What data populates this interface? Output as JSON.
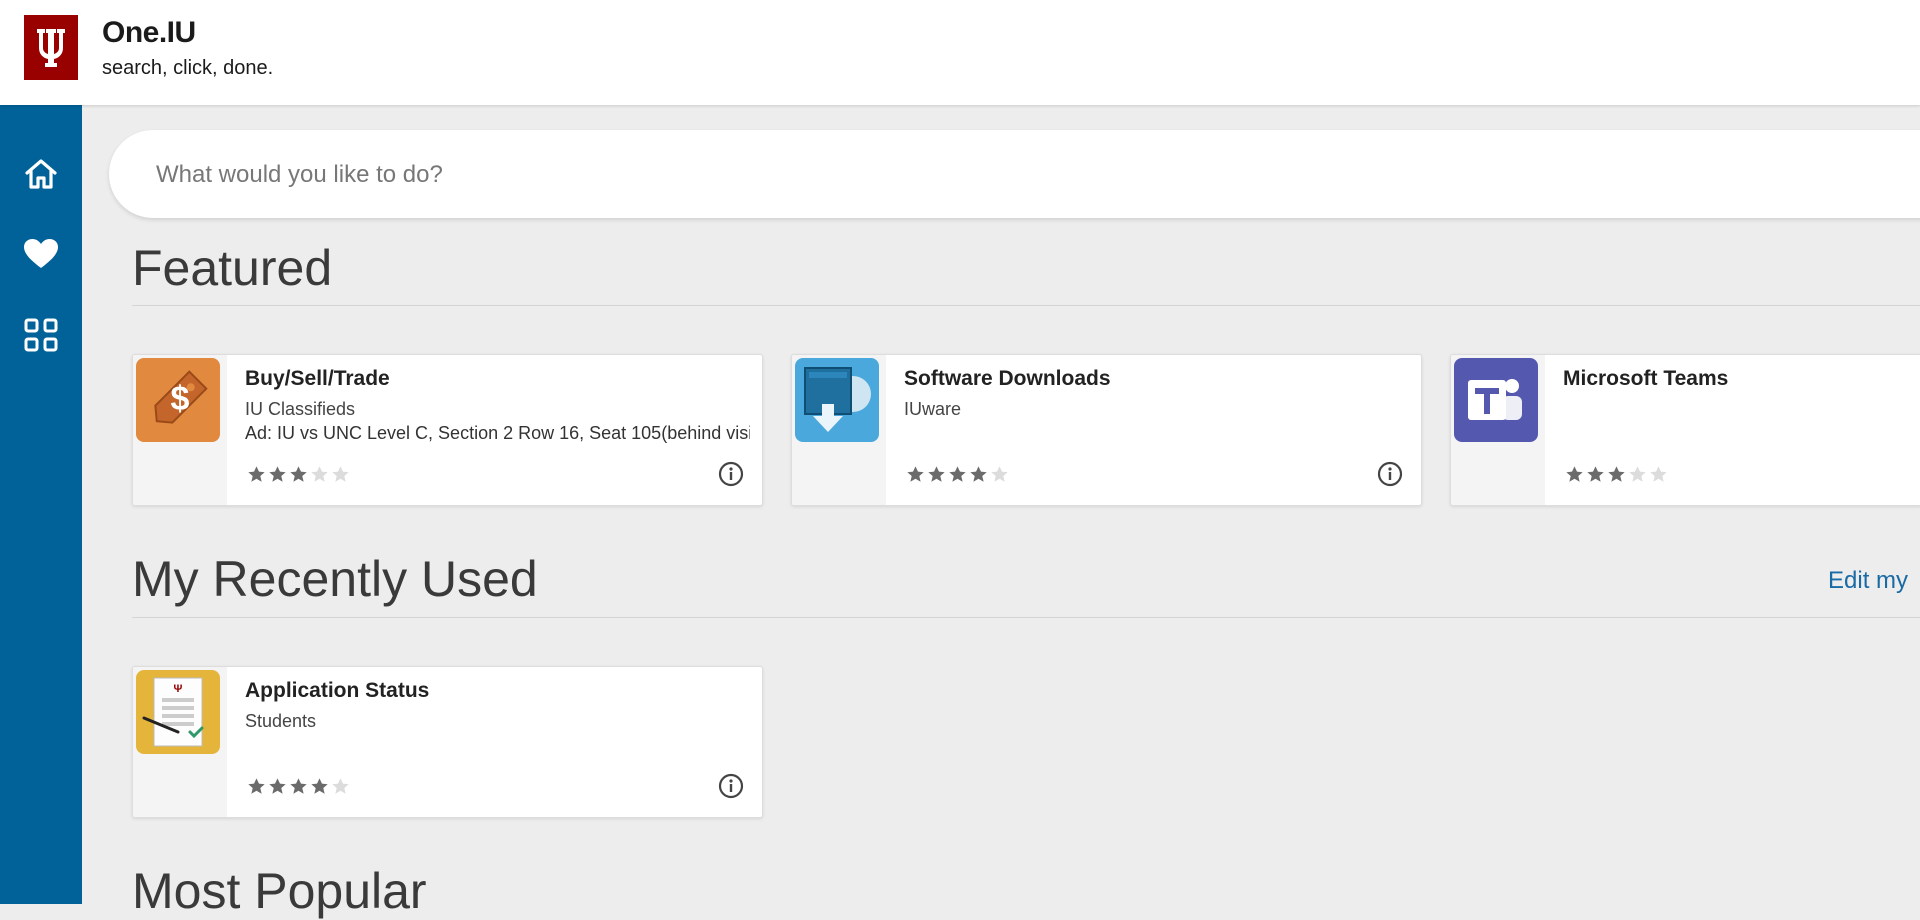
{
  "header": {
    "title": "One.IU",
    "tagline": "search, click, done.",
    "logo_icon": "iu-trident-icon",
    "logo_color": "#990000"
  },
  "sidebar": {
    "color": "#006298",
    "items": [
      {
        "icon": "home-icon"
      },
      {
        "icon": "heart-icon"
      },
      {
        "icon": "grid-icon"
      }
    ]
  },
  "search": {
    "placeholder": "What would you like to do?",
    "value": ""
  },
  "featured": {
    "heading": "Featured",
    "cards": [
      {
        "title": "Buy/Sell/Trade",
        "subtitle": "IU Classifieds",
        "description": "Ad: IU vs UNC Level C, Section 2 Row 16, Seat 105(behind visi",
        "icon": "price-tag-icon",
        "icon_bg": "#e0893f",
        "rating": 3
      },
      {
        "title": "Software Downloads",
        "subtitle": "IUware",
        "description": "",
        "icon": "software-download-icon",
        "icon_bg": "#4aa8dc",
        "rating": 4
      },
      {
        "title": "Microsoft Teams",
        "subtitle": "",
        "description": "",
        "icon": "teams-icon",
        "icon_bg": "#5558af",
        "rating": 3
      }
    ]
  },
  "recent": {
    "heading": "My Recently Used",
    "edit_link": "Edit my",
    "cards": [
      {
        "title": "Application Status",
        "subtitle": "Students",
        "description": "",
        "icon": "document-check-icon",
        "icon_bg": "#e5b43b",
        "rating": 4
      }
    ]
  },
  "popular": {
    "heading": "Most Popular"
  },
  "colors": {
    "star_filled": "#6b6b6b",
    "star_empty": "#dcdcdc",
    "link": "#1a6aa6"
  }
}
